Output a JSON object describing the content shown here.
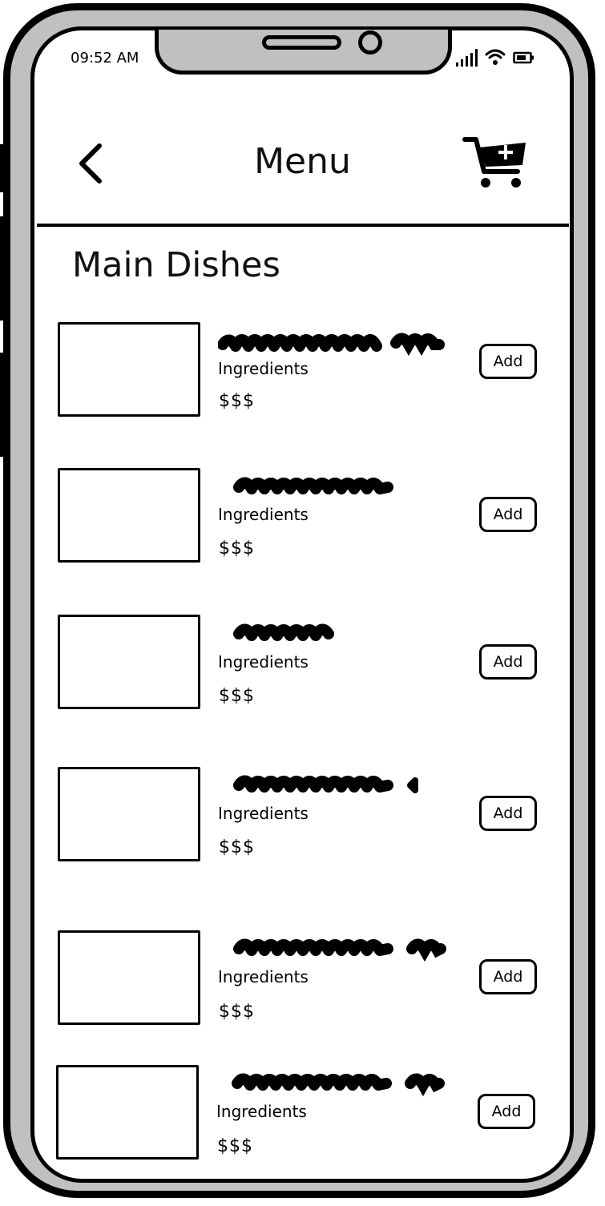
{
  "status_bar": {
    "time": "09:52 AM",
    "icons": [
      "signal-icon",
      "wifi-icon",
      "battery-icon"
    ]
  },
  "header": {
    "title": "Menu",
    "back_icon": "chevron-left-icon",
    "cart_icon": "cart-plus-icon"
  },
  "section": {
    "title": "Main Dishes"
  },
  "menu_items": [
    {
      "ingredients": "Ingredients",
      "price": "$$$",
      "add_label": "Add"
    },
    {
      "ingredients": "Ingredients",
      "price": "$$$",
      "add_label": "Add"
    },
    {
      "ingredients": "Ingredients",
      "price": "$$$",
      "add_label": "Add"
    },
    {
      "ingredients": "Ingredients",
      "price": "$$$",
      "add_label": "Add"
    },
    {
      "ingredients": "Ingredients",
      "price": "$$$",
      "add_label": "Add"
    },
    {
      "ingredients": "Ingredients",
      "price": "$$$",
      "add_label": "Add"
    }
  ]
}
